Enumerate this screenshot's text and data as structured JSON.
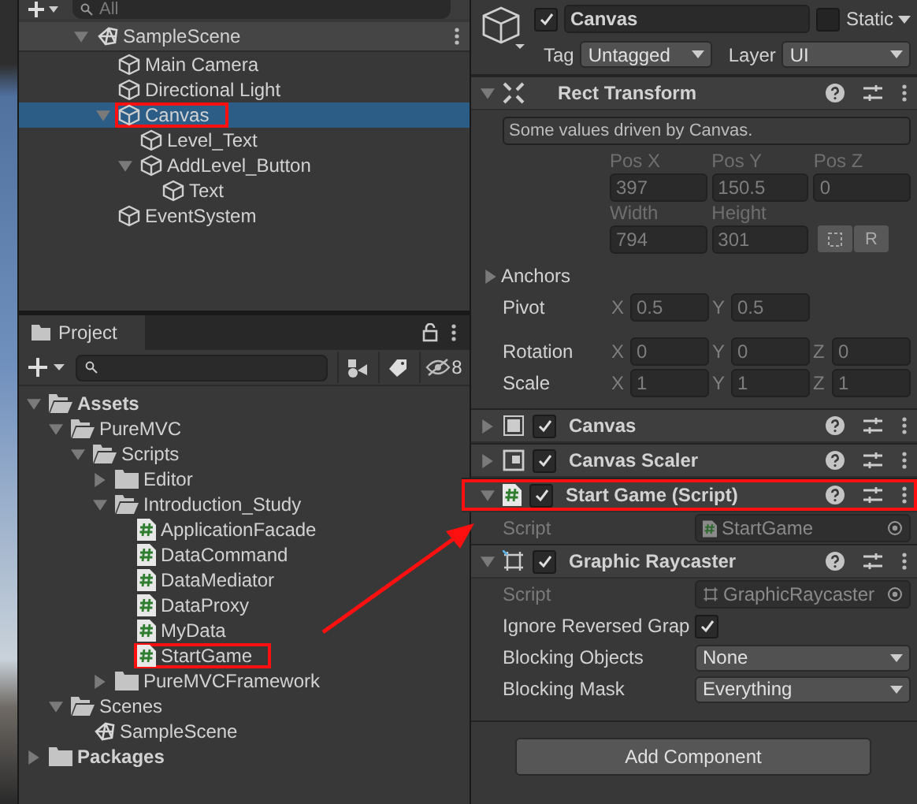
{
  "hierarchy": {
    "search_placeholder": "All",
    "tree": [
      {
        "name": "SampleScene",
        "kind": "scene",
        "expanded": true,
        "selected": false,
        "children": [
          {
            "name": "Main Camera",
            "kind": "object",
            "selected": false
          },
          {
            "name": "Directional Light",
            "kind": "object",
            "selected": false
          },
          {
            "name": "Canvas",
            "kind": "object",
            "selected": true,
            "annotated": true,
            "expanded": true,
            "children": [
              {
                "name": "Level_Text",
                "kind": "object",
                "selected": false
              },
              {
                "name": "AddLevel_Button",
                "kind": "object",
                "selected": false,
                "expanded": true,
                "children": [
                  {
                    "name": "Text",
                    "kind": "object",
                    "selected": false
                  }
                ]
              }
            ]
          },
          {
            "name": "EventSystem",
            "kind": "object",
            "selected": false
          }
        ]
      }
    ]
  },
  "project": {
    "tab": "Project",
    "hidden_count": "8",
    "tree": [
      {
        "name": "Assets",
        "kind": "folder",
        "expanded": true,
        "children": [
          {
            "name": "PureMVC",
            "kind": "folder",
            "expanded": true,
            "children": [
              {
                "name": "Scripts",
                "kind": "folder",
                "expanded": true,
                "children": [
                  {
                    "name": "Editor",
                    "kind": "folder",
                    "expanded": false
                  },
                  {
                    "name": "Introduction_Study",
                    "kind": "folder",
                    "expanded": true,
                    "children": [
                      {
                        "name": "ApplicationFacade",
                        "kind": "script"
                      },
                      {
                        "name": "DataCommand",
                        "kind": "script"
                      },
                      {
                        "name": "DataMediator",
                        "kind": "script"
                      },
                      {
                        "name": "DataProxy",
                        "kind": "script"
                      },
                      {
                        "name": "MyData",
                        "kind": "script"
                      },
                      {
                        "name": "StartGame",
                        "kind": "script",
                        "annotated": true
                      }
                    ]
                  },
                  {
                    "name": "PureMVCFramework",
                    "kind": "folder",
                    "expanded": false
                  }
                ]
              }
            ]
          },
          {
            "name": "Scenes",
            "kind": "folder",
            "expanded": true,
            "children": [
              {
                "name": "SampleScene",
                "kind": "scene"
              }
            ]
          }
        ]
      },
      {
        "name": "Packages",
        "kind": "folder",
        "expanded": false
      }
    ]
  },
  "inspector": {
    "object": {
      "active": true,
      "name": "Canvas",
      "static": false,
      "static_label": "Static",
      "tag_label": "Tag",
      "tag": "Untagged",
      "layer_label": "Layer",
      "layer": "UI"
    },
    "rect_transform": {
      "title": "Rect Transform",
      "expanded": true,
      "note": "Some values driven by Canvas.",
      "position": [
        {
          "label": "Pos X",
          "value": "397"
        },
        {
          "label": "Pos Y",
          "value": "150.5"
        },
        {
          "label": "Pos Z",
          "value": "0"
        }
      ],
      "size": [
        {
          "label": "Width",
          "value": "794"
        },
        {
          "label": "Height",
          "value": "301"
        }
      ],
      "raw_button": "R",
      "anchors": {
        "label": "Anchors",
        "expanded": false
      },
      "vectors": [
        {
          "label": "Pivot",
          "axes": [
            {
              "axis": "X",
              "value": "0.5"
            },
            {
              "axis": "Y",
              "value": "0.5"
            }
          ]
        },
        {
          "label": "Rotation",
          "axes": [
            {
              "axis": "X",
              "value": "0"
            },
            {
              "axis": "Y",
              "value": "0"
            },
            {
              "axis": "Z",
              "value": "0"
            }
          ]
        },
        {
          "label": "Scale",
          "axes": [
            {
              "axis": "X",
              "value": "1"
            },
            {
              "axis": "Y",
              "value": "1"
            },
            {
              "axis": "Z",
              "value": "1"
            }
          ]
        }
      ]
    },
    "components": [
      {
        "kind": "canvas",
        "title": "Canvas",
        "enabled": true,
        "expanded": false
      },
      {
        "kind": "canvas_scaler",
        "title": "Canvas Scaler",
        "enabled": true,
        "expanded": false
      },
      {
        "kind": "script",
        "title": "Start Game (Script)",
        "enabled": true,
        "expanded": true,
        "annotated": true,
        "properties": [
          {
            "kind": "object",
            "label": "Script",
            "value": "StartGame",
            "disabled": true
          }
        ]
      },
      {
        "kind": "raycaster",
        "title": "Graphic Raycaster",
        "enabled": true,
        "expanded": true,
        "properties": [
          {
            "kind": "object",
            "label": "Script",
            "value": "GraphicRaycaster",
            "disabled": true
          },
          {
            "kind": "checkbox",
            "label": "Ignore Reversed Grap",
            "checked": true,
            "disabled": false
          },
          {
            "kind": "dropdown",
            "label": "Blocking Objects",
            "value": "None",
            "disabled": false
          },
          {
            "kind": "dropdown",
            "label": "Blocking Mask",
            "value": "Everything",
            "disabled": false
          }
        ]
      }
    ],
    "add_component": "Add Component"
  }
}
